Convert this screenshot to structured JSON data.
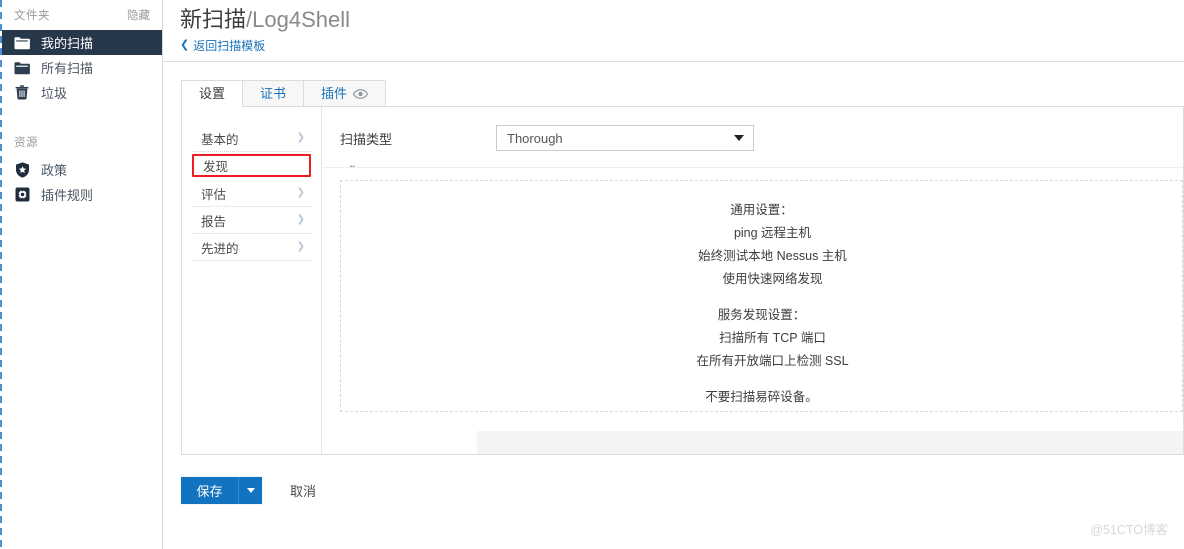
{
  "sidebar": {
    "folders": {
      "title": "文件夹",
      "action": "隐藏",
      "items": [
        {
          "label": "我的扫描",
          "icon": "folder-open-icon",
          "active": true
        },
        {
          "label": "所有扫描",
          "icon": "folder-icon",
          "active": false
        },
        {
          "label": "垃圾",
          "icon": "trash-icon",
          "active": false
        }
      ]
    },
    "resources": {
      "title": "资源",
      "items": [
        {
          "label": "政策",
          "icon": "shield-badge-icon"
        },
        {
          "label": "插件规则",
          "icon": "plugin-rules-icon"
        }
      ]
    }
  },
  "header": {
    "title_main": "新扫描",
    "title_suffix": "/Log4Shell",
    "back_link": "返回扫描模板",
    "back_chevron": "❮"
  },
  "tabs": [
    {
      "label": "设置",
      "active": true,
      "icon": null
    },
    {
      "label": "证书",
      "active": false,
      "icon": null
    },
    {
      "label": "插件",
      "active": false,
      "icon": "eye-icon"
    }
  ],
  "settings_nav": [
    {
      "label": "基本的",
      "arrow": "❯",
      "highlighted": false
    },
    {
      "label": "发现",
      "arrow": "⌄",
      "highlighted": true
    },
    {
      "label": "评估",
      "arrow": "❯",
      "highlighted": false
    },
    {
      "label": "报告",
      "arrow": "❯",
      "highlighted": false
    },
    {
      "label": "先进的",
      "arrow": "❯",
      "highlighted": false
    }
  ],
  "form": {
    "scan_type_label": "扫描类型",
    "scan_type_value": "Thorough",
    "scan_type_options": [
      "Thorough"
    ]
  },
  "summary": {
    "group1_head": "通用设置：",
    "group1_items": [
      "ping 远程主机",
      "始终测试本地 Nessus 主机",
      "使用快速网络发现"
    ],
    "group2_head": "服务发现设置：",
    "group2_items": [
      "扫描所有 TCP 端口",
      "在所有开放端口上检测 SSL"
    ],
    "note": "不要扫描易碎设备。"
  },
  "actions": {
    "save_label": "保存",
    "cancel_label": "取消"
  },
  "watermark": "@51CTO博客",
  "colors": {
    "accent_blue": "#1273c0",
    "link_blue": "#1a72bb",
    "sidebar_active": "#263849",
    "highlight_red": "#ee1d24"
  }
}
